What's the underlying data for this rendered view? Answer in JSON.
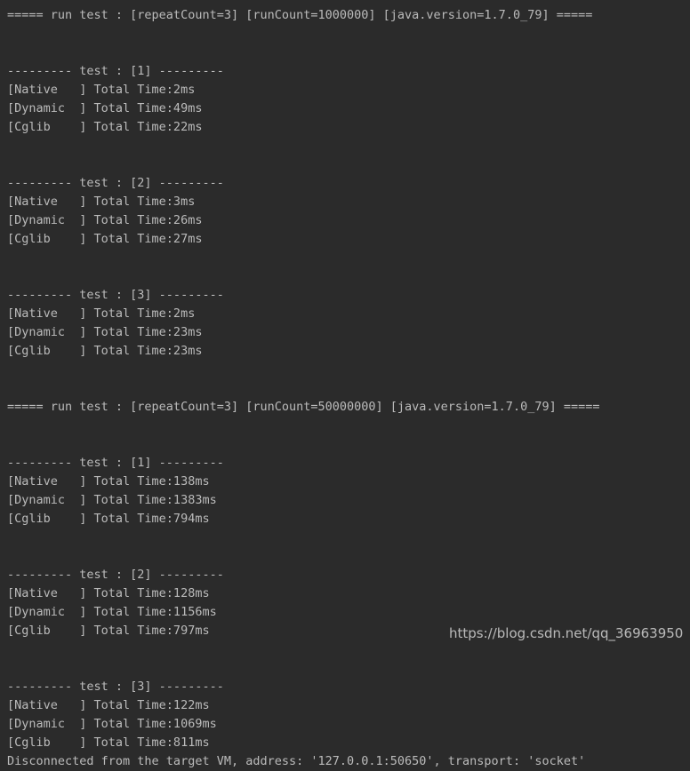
{
  "terminal": {
    "background": "#2b2b2b",
    "foreground": "#bbbbbb",
    "lines": [
      "===== run test : [repeatCount=3] [runCount=1000000] [java.version=1.7.0_79] =====",
      "",
      "",
      "--------- test : [1] ---------",
      "[Native   ] Total Time:2ms",
      "[Dynamic  ] Total Time:49ms",
      "[Cglib    ] Total Time:22ms",
      "",
      "",
      "--------- test : [2] ---------",
      "[Native   ] Total Time:3ms",
      "[Dynamic  ] Total Time:26ms",
      "[Cglib    ] Total Time:27ms",
      "",
      "",
      "--------- test : [3] ---------",
      "[Native   ] Total Time:2ms",
      "[Dynamic  ] Total Time:23ms",
      "[Cglib    ] Total Time:23ms",
      "",
      "",
      "===== run test : [repeatCount=3] [runCount=50000000] [java.version=1.7.0_79] =====",
      "",
      "",
      "--------- test : [1] ---------",
      "[Native   ] Total Time:138ms",
      "[Dynamic  ] Total Time:1383ms",
      "[Cglib    ] Total Time:794ms",
      "",
      "",
      "--------- test : [2] ---------",
      "[Native   ] Total Time:128ms",
      "[Dynamic  ] Total Time:1156ms",
      "[Cglib    ] Total Time:797ms",
      "",
      "",
      "--------- test : [3] ---------",
      "[Native   ] Total Time:122ms",
      "[Dynamic  ] Total Time:1069ms",
      "[Cglib    ] Total Time:811ms",
      "Disconnected from the target VM, address: '127.0.0.1:50650', transport: 'socket'"
    ]
  },
  "watermark": {
    "text": "https://blog.csdn.net/qq_36963950"
  }
}
